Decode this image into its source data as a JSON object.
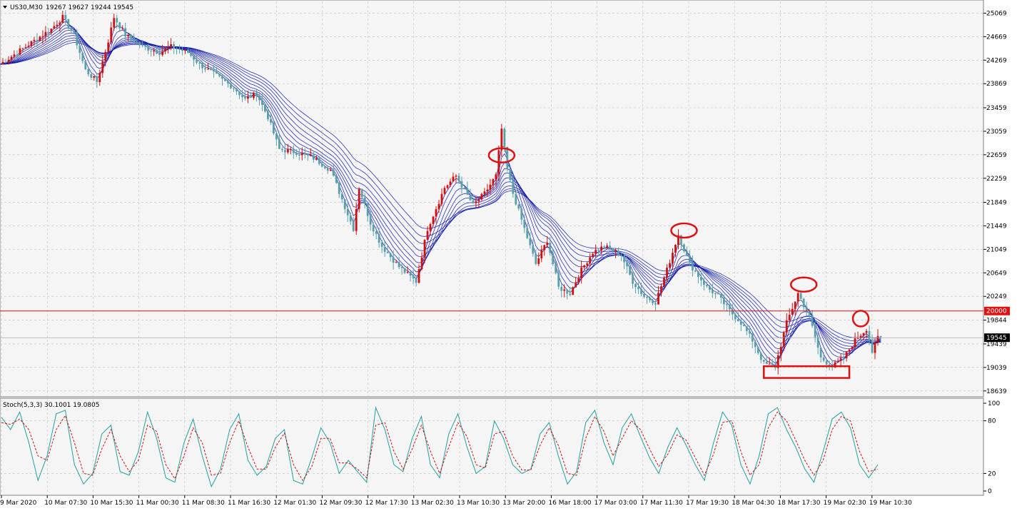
{
  "header": {
    "symbol": "US30,M30",
    "ohlc": "19267 19627 19244 19545"
  },
  "colors": {
    "background": "#f5f5f5",
    "grid": "#c0c0c0",
    "bull_candle": "#d01010",
    "bear_candle": "#5aa0a8",
    "ma_ribbon": "#0a14a8",
    "level_line": "#e01010",
    "annotation": "#e01010",
    "stoch_main": "#20a0a0",
    "stoch_signal": "#d01010"
  },
  "chart_data": [
    {
      "type": "candlestick",
      "panel": "main",
      "symbol": "US30",
      "timeframe": "M30",
      "ylim": [
        18539,
        25269
      ],
      "y_ticks": [
        25069,
        24669,
        24269,
        23869,
        23459,
        23059,
        22659,
        22259,
        21849,
        21449,
        21049,
        20649,
        20249,
        19844,
        19439,
        19039,
        18639
      ],
      "horizontal_level": {
        "value": 20000,
        "label": "20000"
      },
      "current_price": {
        "value": 19545,
        "label": "19545"
      },
      "price_path": [
        [
          0,
          24200
        ],
        [
          6,
          24400
        ],
        [
          12,
          24600
        ],
        [
          18,
          24800
        ],
        [
          22,
          25000
        ],
        [
          26,
          24700
        ],
        [
          30,
          24100
        ],
        [
          34,
          23900
        ],
        [
          38,
          24600
        ],
        [
          40,
          25000
        ],
        [
          44,
          24700
        ],
        [
          50,
          24500
        ],
        [
          56,
          24400
        ],
        [
          60,
          24500
        ],
        [
          66,
          24400
        ],
        [
          70,
          24200
        ],
        [
          76,
          24000
        ],
        [
          82,
          23800
        ],
        [
          86,
          23600
        ],
        [
          90,
          23700
        ],
        [
          94,
          23300
        ],
        [
          98,
          22750
        ],
        [
          104,
          22700
        ],
        [
          110,
          22600
        ],
        [
          116,
          22400
        ],
        [
          120,
          21900
        ],
        [
          124,
          21400
        ],
        [
          126,
          22100
        ],
        [
          130,
          21500
        ],
        [
          134,
          21100
        ],
        [
          140,
          20750
        ],
        [
          146,
          20500
        ],
        [
          150,
          21400
        ],
        [
          156,
          22100
        ],
        [
          160,
          22300
        ],
        [
          166,
          21800
        ],
        [
          170,
          22000
        ],
        [
          174,
          22300
        ],
        [
          176,
          23100
        ],
        [
          178,
          22400
        ],
        [
          180,
          22000
        ],
        [
          184,
          21400
        ],
        [
          188,
          20800
        ],
        [
          192,
          21200
        ],
        [
          196,
          20400
        ],
        [
          200,
          20300
        ],
        [
          204,
          20700
        ],
        [
          208,
          21000
        ],
        [
          212,
          21100
        ],
        [
          218,
          20950
        ],
        [
          222,
          20500
        ],
        [
          226,
          20250
        ],
        [
          230,
          20150
        ],
        [
          234,
          20700
        ],
        [
          238,
          21300
        ],
        [
          242,
          20800
        ],
        [
          248,
          20400
        ],
        [
          252,
          20250
        ],
        [
          256,
          20000
        ],
        [
          260,
          19800
        ],
        [
          264,
          19500
        ],
        [
          268,
          19100
        ],
        [
          272,
          19050
        ],
        [
          276,
          19800
        ],
        [
          280,
          20300
        ],
        [
          284,
          19900
        ],
        [
          288,
          19200
        ],
        [
          292,
          19050
        ],
        [
          296,
          19200
        ],
        [
          300,
          19500
        ],
        [
          304,
          19700
        ],
        [
          306,
          19300
        ],
        [
          308,
          19545
        ]
      ],
      "annotations": [
        {
          "shape": "ellipse",
          "x_index": 176,
          "y": 22650
        },
        {
          "shape": "ellipse",
          "x_index": 240,
          "y": 21370
        },
        {
          "shape": "ellipse",
          "x_index": 282,
          "y": 20450
        },
        {
          "shape": "ellipse",
          "x_index": 302,
          "y": 19870
        },
        {
          "shape": "rectangle",
          "x_from_index": 268,
          "x_to_index": 298,
          "y_from": 19060,
          "y_to": 18860
        }
      ]
    },
    {
      "type": "line",
      "panel": "oscillator",
      "label": "Stoch(5,3,3) 30.1001 19.0805",
      "ylim": [
        0,
        100
      ],
      "y_ticks": [
        100,
        80,
        20,
        0
      ],
      "series": [
        {
          "name": "Main",
          "color": "#20a0a0",
          "values": [
            84,
            70,
            90,
            55,
            12,
            40,
            88,
            92,
            30,
            8,
            20,
            65,
            75,
            22,
            18,
            45,
            90,
            60,
            15,
            10,
            55,
            82,
            40,
            5,
            25,
            70,
            88,
            35,
            18,
            28,
            60,
            70,
            12,
            8,
            38,
            72,
            55,
            20,
            35,
            22,
            10,
            95,
            70,
            30,
            22,
            60,
            85,
            30,
            15,
            65,
            88,
            50,
            20,
            28,
            80,
            60,
            30,
            20,
            25,
            65,
            78,
            40,
            8,
            22,
            78,
            92,
            55,
            30,
            72,
            88,
            62,
            38,
            20,
            50,
            72,
            52,
            30,
            12,
            55,
            90,
            75,
            30,
            8,
            40,
            88,
            95,
            70,
            50,
            25,
            10,
            45,
            82,
            90,
            72,
            30,
            15,
            30
          ]
        },
        {
          "name": "Signal",
          "color": "#d01010",
          "values": [
            78,
            76,
            82,
            70,
            40,
            35,
            70,
            86,
            55,
            20,
            18,
            48,
            70,
            40,
            22,
            35,
            75,
            68,
            30,
            14,
            40,
            72,
            55,
            18,
            20,
            55,
            80,
            50,
            25,
            25,
            50,
            66,
            30,
            12,
            28,
            60,
            60,
            32,
            32,
            25,
            15,
            75,
            78,
            45,
            25,
            48,
            75,
            45,
            20,
            50,
            78,
            62,
            30,
            26,
            65,
            68,
            40,
            24,
            24,
            52,
            72,
            52,
            20,
            18,
            60,
            85,
            68,
            40,
            60,
            80,
            70,
            48,
            28,
            42,
            64,
            58,
            38,
            18,
            42,
            78,
            80,
            45,
            18,
            30,
            72,
            90,
            80,
            58,
            35,
            18,
            35,
            70,
            85,
            80,
            45,
            22,
            25
          ]
        }
      ]
    }
  ],
  "time_axis": [
    "9 Mar 2020",
    "10 Mar 07:30",
    "10 Mar 15:30",
    "11 Mar 00:30",
    "11 Mar 08:30",
    "11 Mar 16:30",
    "12 Mar 01:30",
    "12 Mar 09:30",
    "12 Mar 17:30",
    "13 Mar 02:30",
    "13 Mar 10:30",
    "13 Mar 20:00",
    "16 Mar 18:00",
    "17 Mar 03:00",
    "17 Mar 11:30",
    "17 Mar 19:30",
    "18 Mar 04:30",
    "18 Mar 17:30",
    "19 Mar 02:30",
    "19 Mar 10:30"
  ]
}
